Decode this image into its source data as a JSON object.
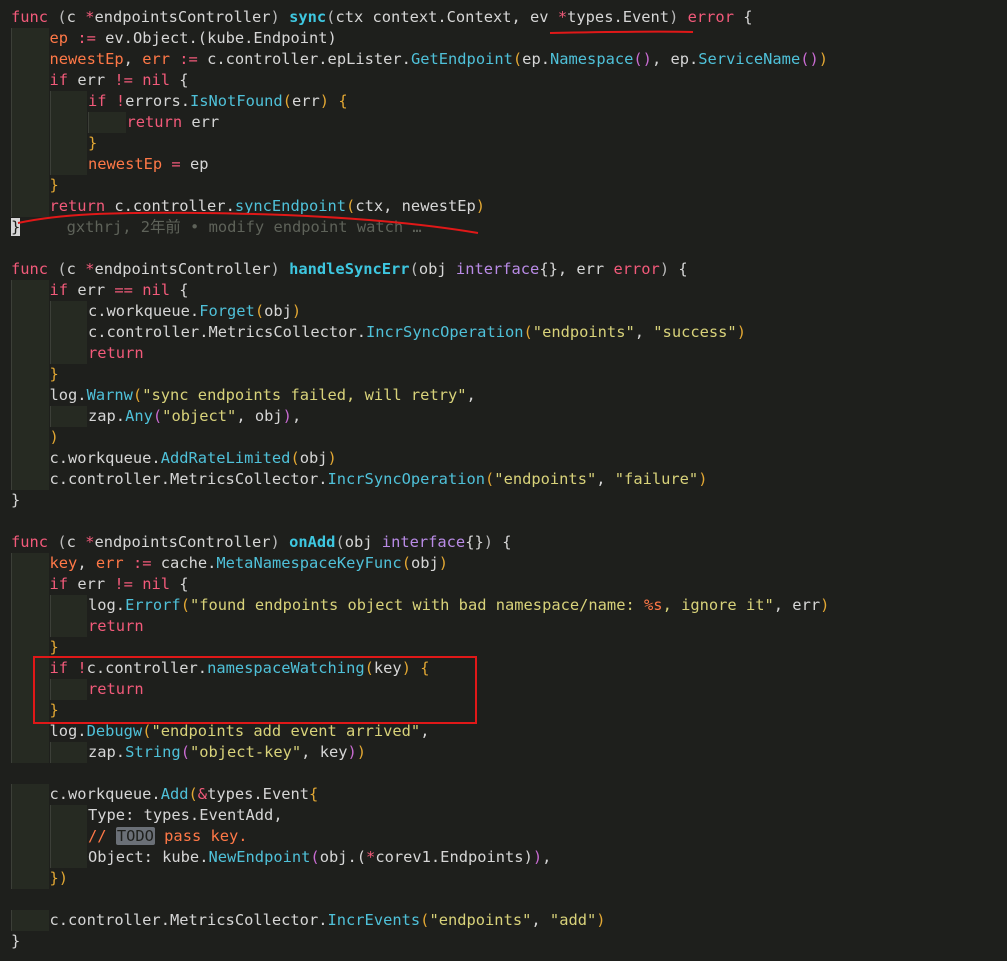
{
  "editor": {
    "language": "go",
    "blame_annotation": "gxthrj, 2年前 • modify endpoint watch …",
    "todo_tag": "TODO",
    "annotation_color": "#e01818"
  },
  "lines": [
    {
      "indent": 0,
      "tokens": [
        [
          "kw",
          "func"
        ],
        [
          "plain",
          " "
        ],
        [
          "punc",
          "("
        ],
        [
          "plain",
          "c "
        ],
        [
          "kw",
          "*"
        ],
        [
          "plain",
          "endpointsController"
        ],
        [
          "punc",
          ")"
        ],
        [
          "plain",
          " "
        ],
        [
          "fndef",
          "sync"
        ],
        [
          "punc",
          "("
        ],
        [
          "plain",
          "ctx context.Context, ev "
        ],
        [
          "kw",
          "*"
        ],
        [
          "plain",
          "types.Event"
        ],
        [
          "punc",
          ")"
        ],
        [
          "plain",
          " "
        ],
        [
          "kw",
          "error"
        ],
        [
          "plain",
          " {"
        ]
      ]
    },
    {
      "indent": 1,
      "tokens": [
        [
          "var",
          "ep"
        ],
        [
          "plain",
          " "
        ],
        [
          "kw",
          ":="
        ],
        [
          "plain",
          " ev.Object.(kube.Endpoint)"
        ]
      ]
    },
    {
      "indent": 1,
      "tokens": [
        [
          "var",
          "newestEp"
        ],
        [
          "plain",
          ", "
        ],
        [
          "var",
          "err"
        ],
        [
          "plain",
          " "
        ],
        [
          "kw",
          ":="
        ],
        [
          "plain",
          " c.controller.epLister."
        ],
        [
          "fn",
          "GetEndpoint"
        ],
        [
          "brk",
          "("
        ],
        [
          "plain",
          "ep."
        ],
        [
          "fn",
          "Namespace"
        ],
        [
          "brk2",
          "()"
        ],
        [
          "plain",
          ", ep."
        ],
        [
          "fn",
          "ServiceName"
        ],
        [
          "brk2",
          "()"
        ],
        [
          "brk",
          ")"
        ]
      ]
    },
    {
      "indent": 1,
      "tokens": [
        [
          "kw",
          "if"
        ],
        [
          "plain",
          " err "
        ],
        [
          "kw",
          "!="
        ],
        [
          "plain",
          " "
        ],
        [
          "kw",
          "nil"
        ],
        [
          "plain",
          " {"
        ]
      ]
    },
    {
      "indent": 2,
      "tokens": [
        [
          "kw",
          "if"
        ],
        [
          "plain",
          " "
        ],
        [
          "kw",
          "!"
        ],
        [
          "plain",
          "errors."
        ],
        [
          "fn",
          "IsNotFound"
        ],
        [
          "brk",
          "("
        ],
        [
          "plain",
          "err"
        ],
        [
          "brk",
          ")"
        ],
        [
          "plain",
          " "
        ],
        [
          "brk",
          "{"
        ]
      ]
    },
    {
      "indent": 3,
      "tokens": [
        [
          "kw",
          "return"
        ],
        [
          "plain",
          " err"
        ]
      ]
    },
    {
      "indent": 2,
      "tokens": [
        [
          "brk",
          "}"
        ]
      ]
    },
    {
      "indent": 2,
      "tokens": [
        [
          "var",
          "newestEp"
        ],
        [
          "plain",
          " "
        ],
        [
          "kw",
          "="
        ],
        [
          "plain",
          " ep"
        ]
      ]
    },
    {
      "indent": 1,
      "tokens": [
        [
          "brk",
          "}"
        ]
      ]
    },
    {
      "indent": 1,
      "tokens": [
        [
          "kw",
          "return"
        ],
        [
          "plain",
          " c.controller."
        ],
        [
          "fn",
          "syncEndpoint"
        ],
        [
          "brk",
          "("
        ],
        [
          "plain",
          "ctx, newestEp"
        ],
        [
          "brk",
          ")"
        ]
      ]
    },
    {
      "indent": 0,
      "tokens": [
        [
          "cursor",
          "}"
        ]
      ],
      "blame": true
    },
    {
      "indent": 0,
      "tokens": []
    },
    {
      "indent": 0,
      "tokens": [
        [
          "kw",
          "func"
        ],
        [
          "plain",
          " "
        ],
        [
          "punc",
          "("
        ],
        [
          "plain",
          "c "
        ],
        [
          "kw",
          "*"
        ],
        [
          "plain",
          "endpointsController"
        ],
        [
          "punc",
          ")"
        ],
        [
          "plain",
          " "
        ],
        [
          "fndef",
          "handleSyncErr"
        ],
        [
          "punc",
          "("
        ],
        [
          "plain",
          "obj "
        ],
        [
          "type",
          "interface"
        ],
        [
          "plain",
          "{}, err "
        ],
        [
          "kw",
          "error"
        ],
        [
          "punc",
          ")"
        ],
        [
          "plain",
          " {"
        ]
      ]
    },
    {
      "indent": 1,
      "tokens": [
        [
          "kw",
          "if"
        ],
        [
          "plain",
          " err "
        ],
        [
          "kw",
          "=="
        ],
        [
          "plain",
          " "
        ],
        [
          "kw",
          "nil"
        ],
        [
          "plain",
          " {"
        ]
      ]
    },
    {
      "indent": 2,
      "tokens": [
        [
          "plain",
          "c.workqueue."
        ],
        [
          "fn",
          "Forget"
        ],
        [
          "brk",
          "("
        ],
        [
          "plain",
          "obj"
        ],
        [
          "brk",
          ")"
        ]
      ]
    },
    {
      "indent": 2,
      "tokens": [
        [
          "plain",
          "c.controller.MetricsCollector."
        ],
        [
          "fn",
          "IncrSyncOperation"
        ],
        [
          "brk",
          "("
        ],
        [
          "str",
          "\"endpoints\""
        ],
        [
          "plain",
          ", "
        ],
        [
          "str",
          "\"success\""
        ],
        [
          "brk",
          ")"
        ]
      ]
    },
    {
      "indent": 2,
      "tokens": [
        [
          "kw",
          "return"
        ]
      ]
    },
    {
      "indent": 1,
      "tokens": [
        [
          "brk",
          "}"
        ]
      ]
    },
    {
      "indent": 1,
      "tokens": [
        [
          "plain",
          "log."
        ],
        [
          "fn",
          "Warnw"
        ],
        [
          "brk",
          "("
        ],
        [
          "str",
          "\"sync endpoints failed, will retry\""
        ],
        [
          "plain",
          ","
        ]
      ]
    },
    {
      "indent": 2,
      "tokens": [
        [
          "plain",
          "zap."
        ],
        [
          "fn",
          "Any"
        ],
        [
          "brk2",
          "("
        ],
        [
          "str",
          "\"object\""
        ],
        [
          "plain",
          ", obj"
        ],
        [
          "brk2",
          ")"
        ],
        [
          "plain",
          ","
        ]
      ]
    },
    {
      "indent": 1,
      "tokens": [
        [
          "brk",
          ")"
        ]
      ]
    },
    {
      "indent": 1,
      "tokens": [
        [
          "plain",
          "c.workqueue."
        ],
        [
          "fn",
          "AddRateLimited"
        ],
        [
          "brk",
          "("
        ],
        [
          "plain",
          "obj"
        ],
        [
          "brk",
          ")"
        ]
      ]
    },
    {
      "indent": 1,
      "tokens": [
        [
          "plain",
          "c.controller.MetricsCollector."
        ],
        [
          "fn",
          "IncrSyncOperation"
        ],
        [
          "brk",
          "("
        ],
        [
          "str",
          "\"endpoints\""
        ],
        [
          "plain",
          ", "
        ],
        [
          "str",
          "\"failure\""
        ],
        [
          "brk",
          ")"
        ]
      ]
    },
    {
      "indent": 0,
      "tokens": [
        [
          "plain",
          "}"
        ]
      ]
    },
    {
      "indent": 0,
      "tokens": []
    },
    {
      "indent": 0,
      "tokens": [
        [
          "kw",
          "func"
        ],
        [
          "plain",
          " "
        ],
        [
          "punc",
          "("
        ],
        [
          "plain",
          "c "
        ],
        [
          "kw",
          "*"
        ],
        [
          "plain",
          "endpointsController"
        ],
        [
          "punc",
          ")"
        ],
        [
          "plain",
          " "
        ],
        [
          "fndef",
          "onAdd"
        ],
        [
          "punc",
          "("
        ],
        [
          "plain",
          "obj "
        ],
        [
          "type",
          "interface"
        ],
        [
          "plain",
          "{}"
        ],
        [
          "punc",
          ")"
        ],
        [
          "plain",
          " {"
        ]
      ]
    },
    {
      "indent": 1,
      "tokens": [
        [
          "var",
          "key"
        ],
        [
          "plain",
          ", "
        ],
        [
          "var",
          "err"
        ],
        [
          "plain",
          " "
        ],
        [
          "kw",
          ":="
        ],
        [
          "plain",
          " cache."
        ],
        [
          "fn",
          "MetaNamespaceKeyFunc"
        ],
        [
          "brk",
          "("
        ],
        [
          "plain",
          "obj"
        ],
        [
          "brk",
          ")"
        ]
      ]
    },
    {
      "indent": 1,
      "tokens": [
        [
          "kw",
          "if"
        ],
        [
          "plain",
          " err "
        ],
        [
          "kw",
          "!="
        ],
        [
          "plain",
          " "
        ],
        [
          "kw",
          "nil"
        ],
        [
          "plain",
          " {"
        ]
      ]
    },
    {
      "indent": 2,
      "tokens": [
        [
          "plain",
          "log."
        ],
        [
          "fn",
          "Errorf"
        ],
        [
          "brk",
          "("
        ],
        [
          "str",
          "\"found endpoints object with bad namespace/name: "
        ],
        [
          "var",
          "%s"
        ],
        [
          "str",
          ", ignore it\""
        ],
        [
          "plain",
          ", err"
        ],
        [
          "brk",
          ")"
        ]
      ]
    },
    {
      "indent": 2,
      "tokens": [
        [
          "kw",
          "return"
        ]
      ]
    },
    {
      "indent": 1,
      "tokens": [
        [
          "brk",
          "}"
        ]
      ]
    },
    {
      "indent": 1,
      "tokens": [
        [
          "kw",
          "if"
        ],
        [
          "plain",
          " "
        ],
        [
          "kw",
          "!"
        ],
        [
          "plain",
          "c.controller."
        ],
        [
          "fn",
          "namespaceWatching"
        ],
        [
          "brk",
          "("
        ],
        [
          "plain",
          "key"
        ],
        [
          "brk",
          ")"
        ],
        [
          "plain",
          " "
        ],
        [
          "brk",
          "{"
        ]
      ]
    },
    {
      "indent": 2,
      "tokens": [
        [
          "kw",
          "return"
        ]
      ]
    },
    {
      "indent": 1,
      "tokens": [
        [
          "brk",
          "}"
        ]
      ]
    },
    {
      "indent": 1,
      "tokens": [
        [
          "plain",
          "log."
        ],
        [
          "fn",
          "Debugw"
        ],
        [
          "brk",
          "("
        ],
        [
          "str",
          "\"endpoints add event arrived\""
        ],
        [
          "plain",
          ","
        ]
      ]
    },
    {
      "indent": 2,
      "tokens": [
        [
          "plain",
          "zap."
        ],
        [
          "fn",
          "String"
        ],
        [
          "brk2",
          "("
        ],
        [
          "str",
          "\"object-key\""
        ],
        [
          "plain",
          ", key"
        ],
        [
          "brk2",
          ")"
        ],
        [
          "brk",
          ")"
        ]
      ]
    },
    {
      "indent": 0,
      "tokens": []
    },
    {
      "indent": 1,
      "tokens": [
        [
          "plain",
          "c.workqueue."
        ],
        [
          "fn",
          "Add"
        ],
        [
          "brk",
          "("
        ],
        [
          "kw",
          "&"
        ],
        [
          "plain",
          "types.Event"
        ],
        [
          "brk",
          "{"
        ]
      ]
    },
    {
      "indent": 2,
      "tokens": [
        [
          "plain",
          "Type: types.EventAdd,"
        ]
      ]
    },
    {
      "indent": 2,
      "tokens": [
        [
          "com",
          "// "
        ],
        [
          "todo",
          "TODO"
        ],
        [
          "com",
          " pass key."
        ]
      ]
    },
    {
      "indent": 2,
      "tokens": [
        [
          "plain",
          "Object: kube."
        ],
        [
          "fn",
          "NewEndpoint"
        ],
        [
          "brk2",
          "("
        ],
        [
          "plain",
          "obj.("
        ],
        [
          "kw",
          "*"
        ],
        [
          "plain",
          "corev1.Endpoints"
        ],
        [
          "plain",
          ")"
        ],
        [
          "brk2",
          ")"
        ],
        [
          "plain",
          ","
        ]
      ]
    },
    {
      "indent": 1,
      "tokens": [
        [
          "brk",
          "})"
        ]
      ]
    },
    {
      "indent": 0,
      "tokens": []
    },
    {
      "indent": 1,
      "tokens": [
        [
          "plain",
          "c.controller.MetricsCollector."
        ],
        [
          "fn",
          "IncrEvents"
        ],
        [
          "brk",
          "("
        ],
        [
          "str",
          "\"endpoints\""
        ],
        [
          "plain",
          ", "
        ],
        [
          "str",
          "\"add\""
        ],
        [
          "brk",
          ")"
        ]
      ]
    },
    {
      "indent": 0,
      "tokens": [
        [
          "plain",
          "}"
        ]
      ]
    }
  ]
}
